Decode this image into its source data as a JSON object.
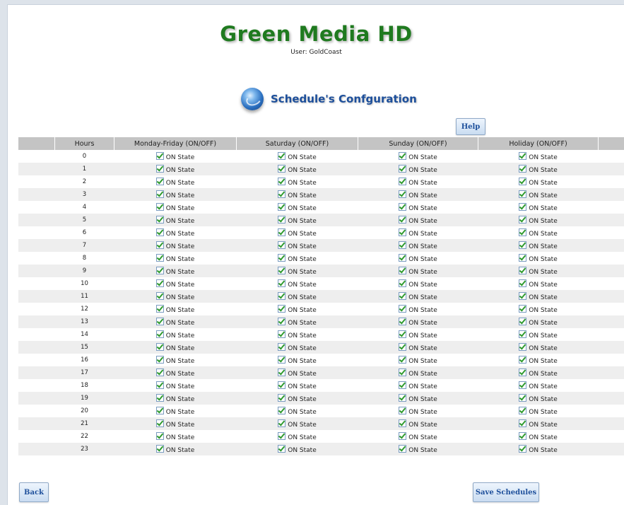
{
  "header": {
    "app_title": "Green Media HD",
    "user_line": "User: GoldCoast"
  },
  "section": {
    "icon": "globe-icon",
    "title": "Schedule's Confguration"
  },
  "buttons": {
    "help": "Help",
    "back": "Back",
    "save": "Save Schedules"
  },
  "table": {
    "columns": [
      "Hours",
      "Monday-Friday (ON/OFF)",
      "Saturday (ON/OFF)",
      "Sunday (ON/OFF)",
      "Holiday (ON/OFF)"
    ],
    "state_label": "ON State",
    "rows": [
      {
        "hour": "0",
        "weekday": true,
        "saturday": true,
        "sunday": true,
        "holiday": true
      },
      {
        "hour": "1",
        "weekday": true,
        "saturday": true,
        "sunday": true,
        "holiday": true
      },
      {
        "hour": "2",
        "weekday": true,
        "saturday": true,
        "sunday": true,
        "holiday": true
      },
      {
        "hour": "3",
        "weekday": true,
        "saturday": true,
        "sunday": true,
        "holiday": true
      },
      {
        "hour": "4",
        "weekday": true,
        "saturday": true,
        "sunday": true,
        "holiday": true
      },
      {
        "hour": "5",
        "weekday": true,
        "saturday": true,
        "sunday": true,
        "holiday": true
      },
      {
        "hour": "6",
        "weekday": true,
        "saturday": true,
        "sunday": true,
        "holiday": true
      },
      {
        "hour": "7",
        "weekday": true,
        "saturday": true,
        "sunday": true,
        "holiday": true
      },
      {
        "hour": "8",
        "weekday": true,
        "saturday": true,
        "sunday": true,
        "holiday": true
      },
      {
        "hour": "9",
        "weekday": true,
        "saturday": true,
        "sunday": true,
        "holiday": true
      },
      {
        "hour": "10",
        "weekday": true,
        "saturday": true,
        "sunday": true,
        "holiday": true
      },
      {
        "hour": "11",
        "weekday": true,
        "saturday": true,
        "sunday": true,
        "holiday": true
      },
      {
        "hour": "12",
        "weekday": true,
        "saturday": true,
        "sunday": true,
        "holiday": true
      },
      {
        "hour": "13",
        "weekday": true,
        "saturday": true,
        "sunday": true,
        "holiday": true
      },
      {
        "hour": "14",
        "weekday": true,
        "saturday": true,
        "sunday": true,
        "holiday": true
      },
      {
        "hour": "15",
        "weekday": true,
        "saturday": true,
        "sunday": true,
        "holiday": true
      },
      {
        "hour": "16",
        "weekday": true,
        "saturday": true,
        "sunday": true,
        "holiday": true
      },
      {
        "hour": "17",
        "weekday": true,
        "saturday": true,
        "sunday": true,
        "holiday": true
      },
      {
        "hour": "18",
        "weekday": true,
        "saturday": true,
        "sunday": true,
        "holiday": true
      },
      {
        "hour": "19",
        "weekday": true,
        "saturday": true,
        "sunday": true,
        "holiday": true
      },
      {
        "hour": "20",
        "weekday": true,
        "saturday": true,
        "sunday": true,
        "holiday": true
      },
      {
        "hour": "21",
        "weekday": true,
        "saturday": true,
        "sunday": true,
        "holiday": true
      },
      {
        "hour": "22",
        "weekday": true,
        "saturday": true,
        "sunday": true,
        "holiday": true
      },
      {
        "hour": "23",
        "weekday": true,
        "saturday": true,
        "sunday": true,
        "holiday": true
      }
    ]
  },
  "colors": {
    "title_green": "#1f7a1f",
    "section_blue": "#1d4f9b",
    "header_gray": "#c4c4c4",
    "check_green": "#2f9a2f"
  }
}
